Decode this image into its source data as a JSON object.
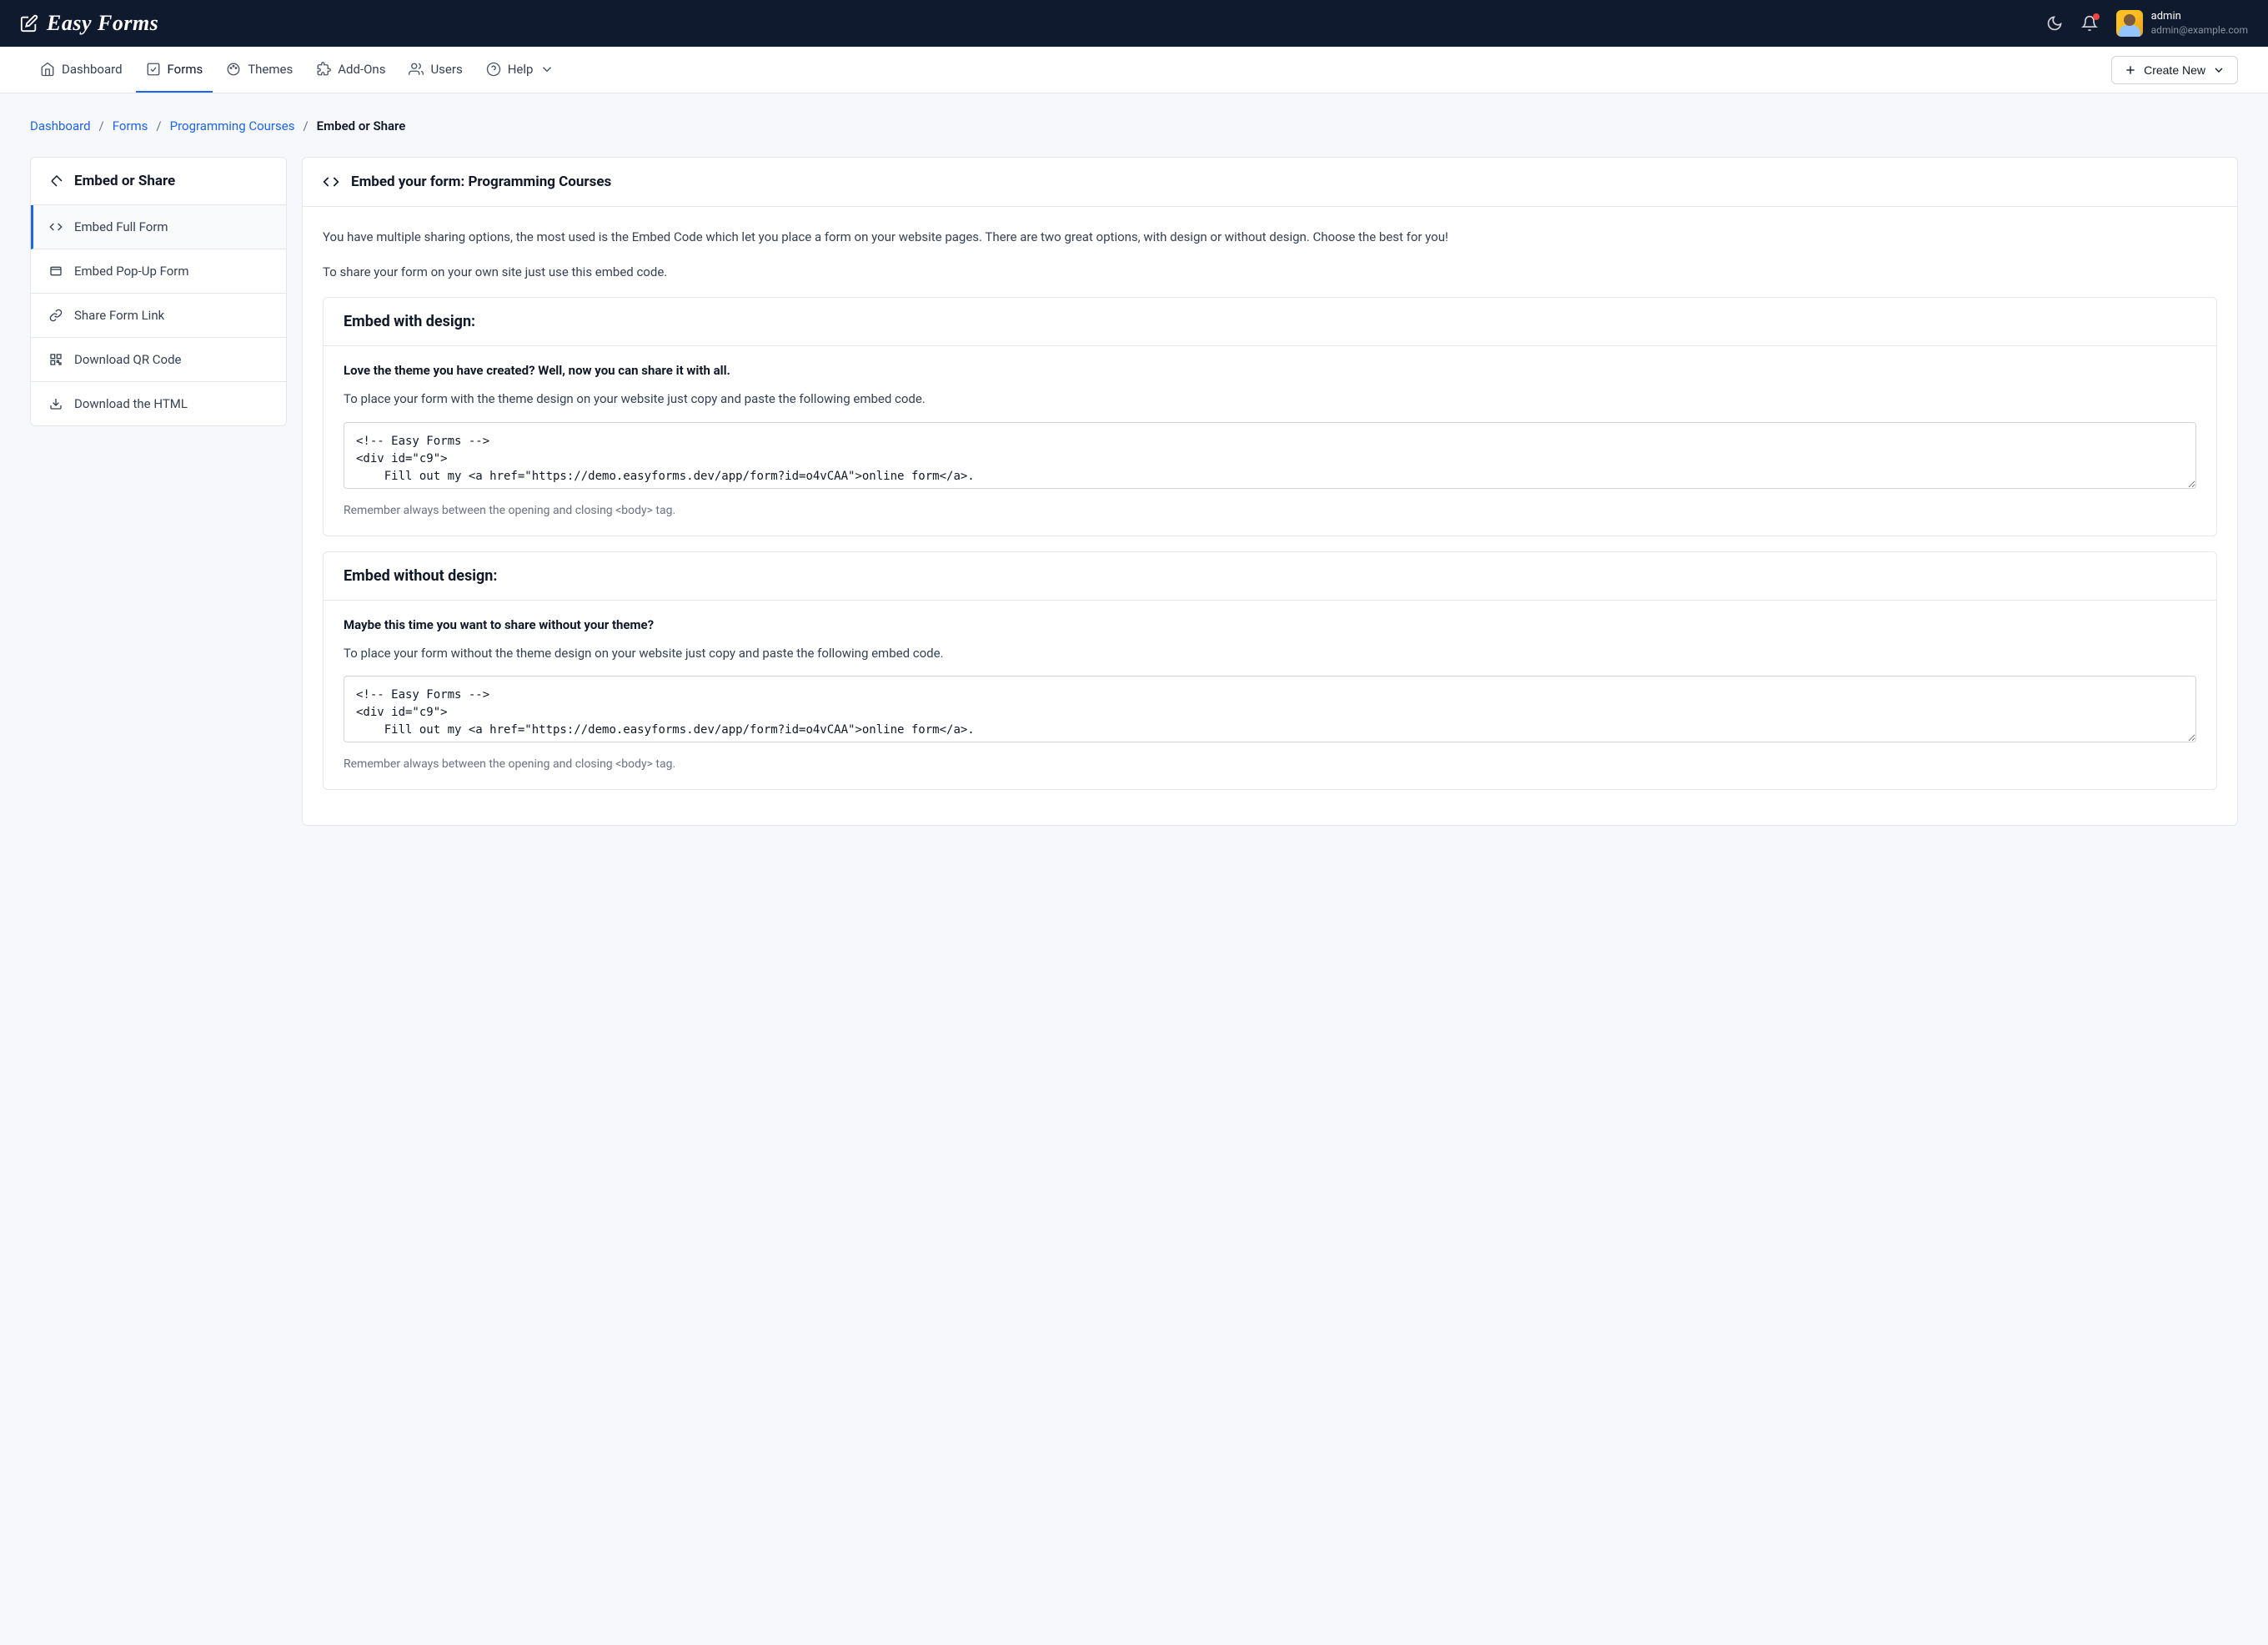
{
  "brand": "Easy Forms",
  "user": {
    "name": "admin",
    "email": "admin@example.com"
  },
  "nav": {
    "items": [
      {
        "label": "Dashboard"
      },
      {
        "label": "Forms"
      },
      {
        "label": "Themes"
      },
      {
        "label": "Add-Ons"
      },
      {
        "label": "Users"
      },
      {
        "label": "Help"
      }
    ],
    "create": "Create New"
  },
  "breadcrumb": {
    "items": [
      "Dashboard",
      "Forms",
      "Programming Courses"
    ],
    "current": "Embed or Share"
  },
  "sidebar": {
    "title": "Embed or Share",
    "items": [
      {
        "label": "Embed Full Form"
      },
      {
        "label": "Embed Pop-Up Form"
      },
      {
        "label": "Share Form Link"
      },
      {
        "label": "Download QR Code"
      },
      {
        "label": "Download the HTML"
      }
    ]
  },
  "panel": {
    "title": "Embed your form: Programming Courses",
    "intro1": "You have multiple sharing options, the most used is the Embed Code which let you place a form on your website pages. There are two great options, with design or without design. Choose the best for you!",
    "intro2": "To share your form on your own site just use this embed code.",
    "blocks": [
      {
        "title": "Embed with design:",
        "sub": "Love the theme you have created? Well, now you can share it with all.",
        "desc": "To place your form with the theme design on your website just copy and paste the following embed code.",
        "code": "<!-- Easy Forms -->\n<div id=\"c9\">\n    Fill out my <a href=\"https://demo.easyforms.dev/app/form?id=o4vCAA\">online form</a>.",
        "hint": "Remember always between the opening and closing <body> tag."
      },
      {
        "title": "Embed without design:",
        "sub": "Maybe this time you want to share without your theme?",
        "desc": "To place your form without the theme design on your website just copy and paste the following embed code.",
        "code": "<!-- Easy Forms -->\n<div id=\"c9\">\n    Fill out my <a href=\"https://demo.easyforms.dev/app/form?id=o4vCAA\">online form</a>.",
        "hint": "Remember always between the opening and closing <body> tag."
      }
    ]
  }
}
